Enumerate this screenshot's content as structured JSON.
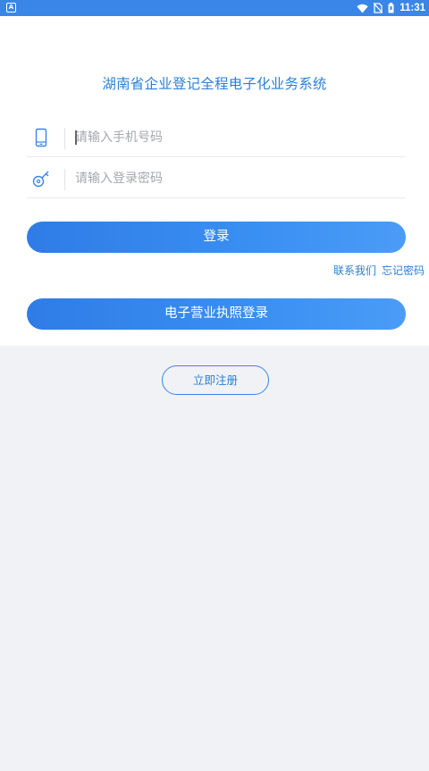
{
  "status_bar": {
    "time": "11:31",
    "notification_icon": "a-icon",
    "icons": [
      "wifi-icon",
      "no-sim-icon",
      "battery-icon"
    ]
  },
  "app": {
    "title": "湖南省企业登记全程电子化业务系统"
  },
  "login_form": {
    "phone": {
      "icon": "phone-icon",
      "value": "",
      "placeholder": "请输入手机号码"
    },
    "password": {
      "icon": "key-icon",
      "value": "",
      "placeholder": "请输入登录密码"
    },
    "login_label": "登录",
    "contact_label": "联系我们",
    "forgot_label": "忘记密码",
    "license_login_label": "电子营业执照登录"
  },
  "register_label": "立即注册",
  "colors": {
    "accent": "#3a85e8",
    "title": "#2a7fd6",
    "background": "#f1f2f5",
    "card": "#ffffff"
  }
}
